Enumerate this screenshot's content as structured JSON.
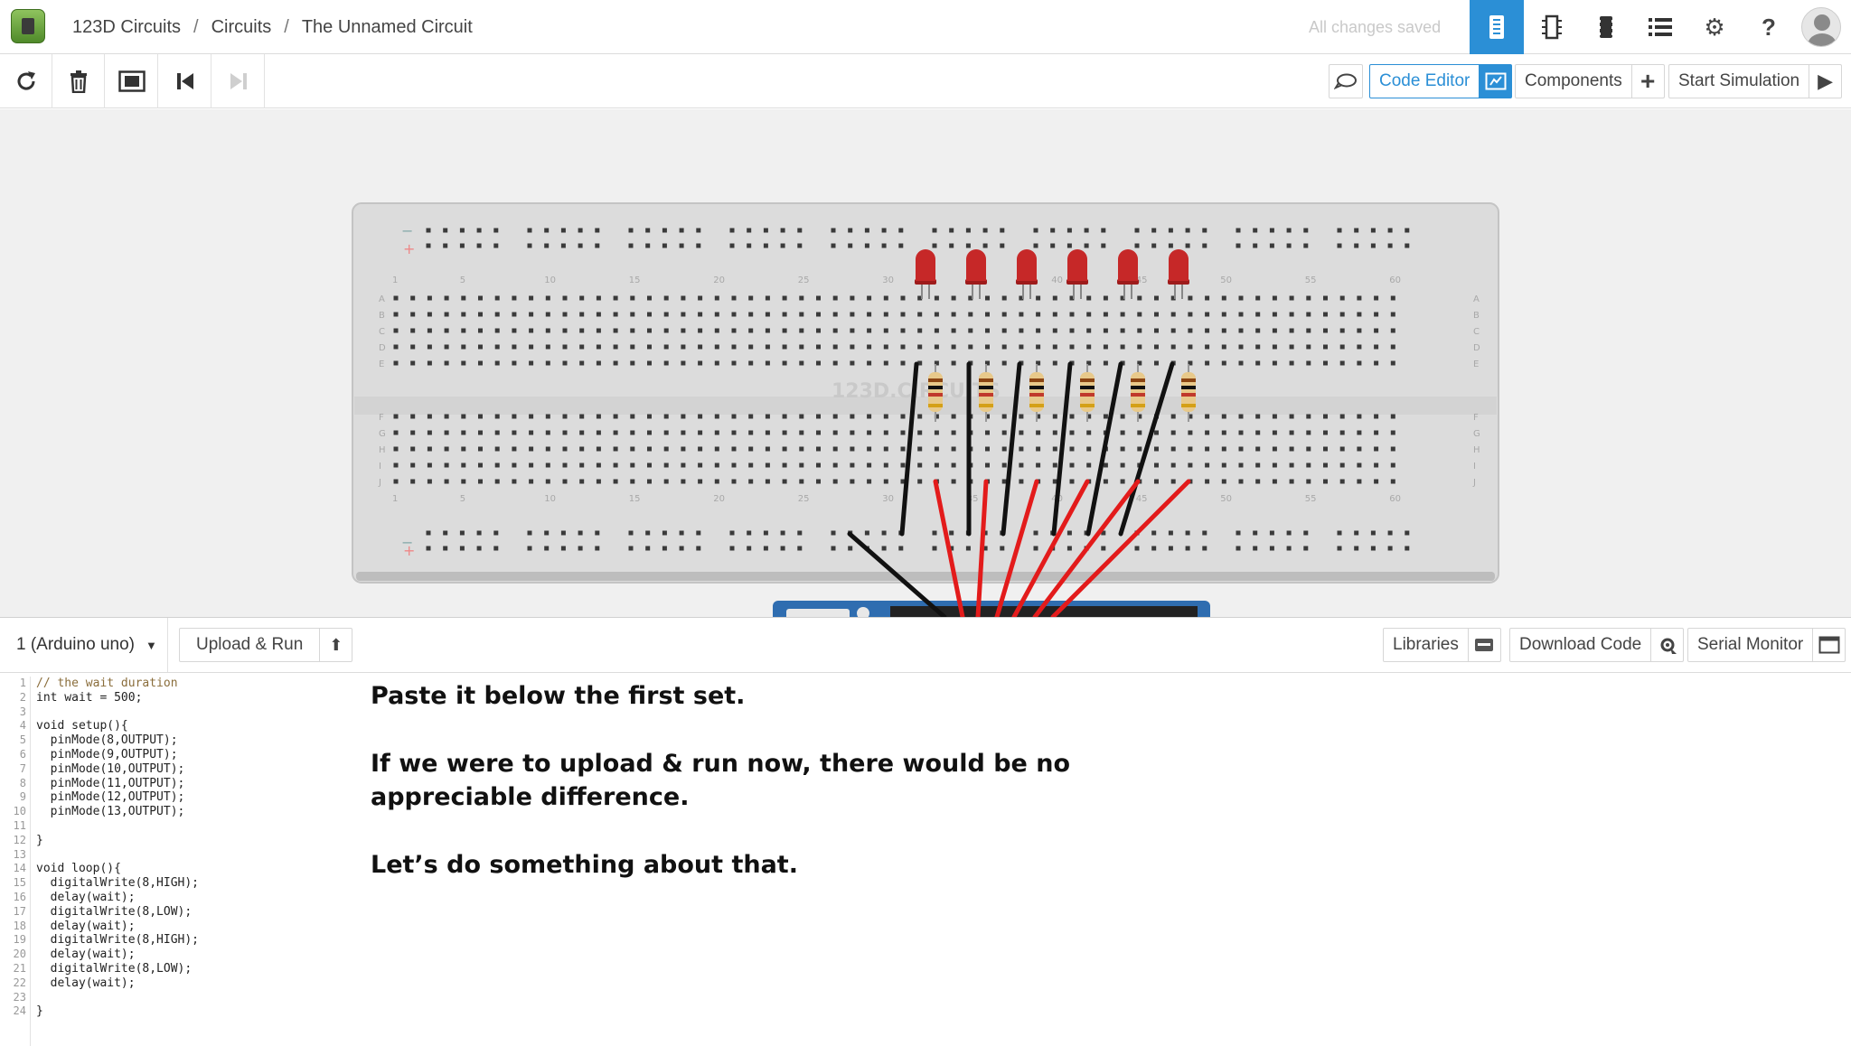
{
  "header": {
    "breadcrumbs": [
      "123D Circuits",
      "Circuits",
      "The Unnamed Circuit"
    ],
    "separator": "/",
    "save_status": "All changes saved",
    "view_icons": [
      "breadboard-view-icon",
      "schematic-view-icon",
      "pcb-view-icon",
      "list-view-icon"
    ],
    "settings_icon": "gear-icon",
    "help_label": "?",
    "accent_color": "#2b8fd6"
  },
  "toolbar": {
    "tools": [
      "rotate-icon",
      "trash-icon",
      "fit-to-screen-icon",
      "step-back-icon",
      "step-forward-icon"
    ],
    "code_editor_label": "Code Editor",
    "components_label": "Components",
    "components_icon": "+",
    "start_simulation_label": "Start Simulation",
    "start_simulation_icon": "▶"
  },
  "breadboard": {
    "column_numbers": [
      "1",
      "5",
      "10",
      "15",
      "20",
      "25",
      "30",
      "35",
      "40",
      "45",
      "50",
      "55",
      "60"
    ],
    "row_letters_top": [
      "A",
      "B",
      "C",
      "D",
      "E"
    ],
    "row_letters_bottom": [
      "F",
      "G",
      "H",
      "I",
      "J"
    ],
    "rail_minus": "−",
    "rail_plus": "+",
    "watermark": "123D.CIRCUITS",
    "led_count": 6,
    "resistor_count": 6,
    "led_color": "#c62828",
    "wire_colors": [
      "#111111",
      "#e31b1b"
    ]
  },
  "code_panel": {
    "device_label": "1 (Arduino uno)",
    "upload_run_label": "Upload & Run",
    "upload_icon": "⬆",
    "libraries_label": "Libraries",
    "download_code_label": "Download Code",
    "serial_monitor_label": "Serial Monitor"
  },
  "code_lines": [
    "// the wait duration",
    "int wait = 500;",
    "",
    "void setup(){",
    "  pinMode(8,OUTPUT);",
    "  pinMode(9,OUTPUT);",
    "  pinMode(10,OUTPUT);",
    "  pinMode(11,OUTPUT);",
    "  pinMode(12,OUTPUT);",
    "  pinMode(13,OUTPUT);",
    "",
    "}",
    "",
    "void loop(){",
    "  digitalWrite(8,HIGH);",
    "  delay(wait);",
    "  digitalWrite(8,LOW);",
    "  delay(wait);",
    "  digitalWrite(8,HIGH);",
    "  delay(wait);",
    "  digitalWrite(8,LOW);",
    "  delay(wait);",
    "",
    "}"
  ],
  "narration": {
    "line1": "Paste it below the first set.",
    "line2a": "If we were to upload & run now, there would be no",
    "line2b": "appreciable difference.",
    "line3": "Let’s do something about that."
  }
}
